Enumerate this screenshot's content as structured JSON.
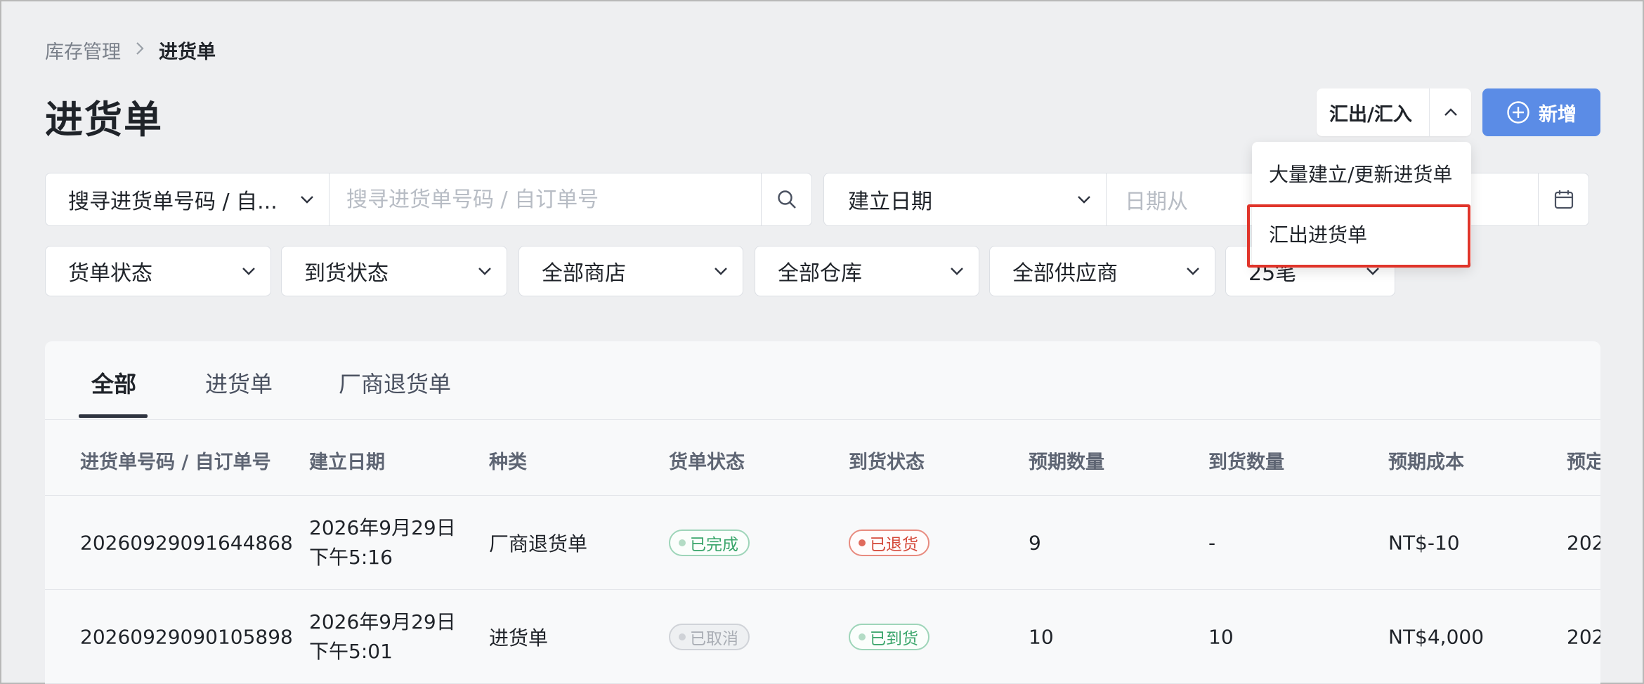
{
  "breadcrumb": {
    "parent": "库存管理",
    "separator": ">",
    "current": "进货单"
  },
  "page_title": "进货单",
  "header_actions": {
    "export_import": "汇出/汇入",
    "add": "新增"
  },
  "search": {
    "field_select": "搜寻进货单号码 / 自...",
    "placeholder": "搜寻进货单号码 / 自订单号"
  },
  "date_filter": {
    "field_select": "建立日期",
    "from_placeholder": "日期从"
  },
  "filters": [
    "货单状态",
    "到货状态",
    "全部商店",
    "全部仓库",
    "全部供应商",
    "25笔"
  ],
  "dropdown_menu": {
    "items": [
      "大量建立/更新进货单",
      "汇出进货单"
    ],
    "highlighted_index": 1
  },
  "tabs": [
    {
      "label": "全部",
      "active": true
    },
    {
      "label": "进货单",
      "active": false
    },
    {
      "label": "厂商退货单",
      "active": false
    }
  ],
  "table": {
    "columns": [
      "进货单号码 / 自订单号",
      "建立日期",
      "种类",
      "货单状态",
      "到货状态",
      "预期数量",
      "到货数量",
      "预期成本",
      "预定"
    ],
    "rows": [
      {
        "number": "20260929091644868",
        "date_line1": "2026年9月29日",
        "date_line2": "下午5:16",
        "type": "厂商退货单",
        "order_status": "已完成",
        "arrival_status": "已退货",
        "expected_qty": "9",
        "received_qty": "-",
        "expected_cost": "NT$-10",
        "scheduled": "202"
      },
      {
        "number": "20260929090105898",
        "date_line1": "2026年9月29日",
        "date_line2": "下午5:01",
        "type": "进货单",
        "order_status": "已取消",
        "arrival_status": "已到货",
        "expected_qty": "10",
        "received_qty": "10",
        "expected_cost": "NT$4,000",
        "scheduled": "202"
      }
    ]
  },
  "colors": {
    "primary": "#5b8ce6",
    "highlight": "#e0342a",
    "success": "#3aa56b",
    "danger": "#d4493a"
  },
  "icons": [
    "chevron-right-icon",
    "chevron-up-icon",
    "plus-circle-icon",
    "chevron-down-icon",
    "search-icon",
    "calendar-icon"
  ]
}
